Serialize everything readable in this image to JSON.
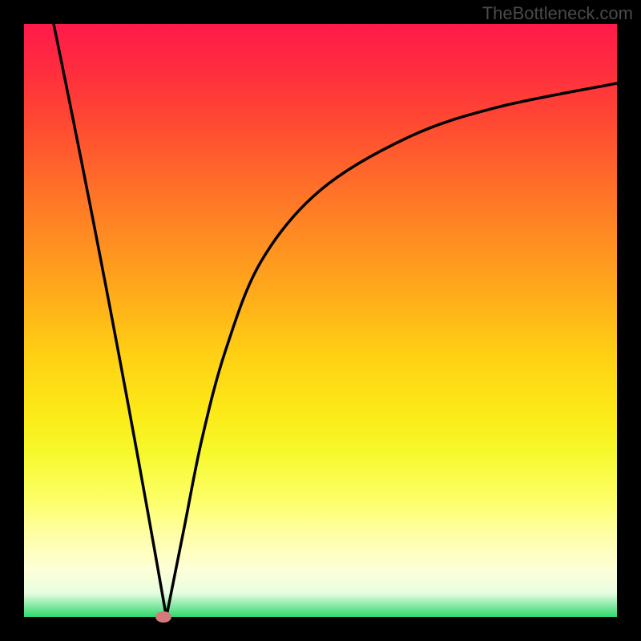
{
  "watermark": "TheBottleneck.com",
  "colors": {
    "curve_stroke": "#000000",
    "marker_fill": "#d47a7a",
    "background": "#000000"
  },
  "chart_data": {
    "type": "line",
    "title": "",
    "xlabel": "",
    "ylabel": "",
    "xlim": [
      0,
      1
    ],
    "ylim": [
      0,
      1
    ],
    "left_branch": {
      "x_start": 0.05,
      "y_start": 1.0,
      "x_end": 0.24,
      "y_end": 0.0
    },
    "right_branch": {
      "x": [
        0.24,
        0.27,
        0.3,
        0.34,
        0.4,
        0.5,
        0.65,
        0.8,
        1.0
      ],
      "y": [
        0.0,
        0.15,
        0.3,
        0.45,
        0.6,
        0.72,
        0.81,
        0.86,
        0.9
      ]
    },
    "optimum": {
      "x": 0.235,
      "y": 0.0
    },
    "series": [
      {
        "name": "bottleneck",
        "x_normalized": "see left_branch + right_branch"
      }
    ]
  }
}
